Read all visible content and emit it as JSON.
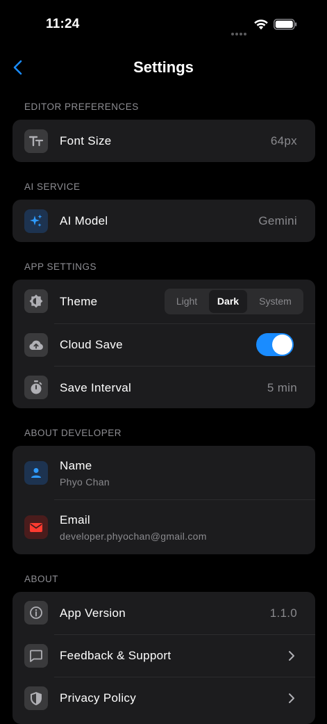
{
  "status": {
    "time": "11:24"
  },
  "nav": {
    "title": "Settings"
  },
  "editor": {
    "header": "EDITOR PREFERENCES",
    "font_size": {
      "label": "Font Size",
      "value": "64px"
    }
  },
  "ai": {
    "header": "AI SERVICE",
    "model": {
      "label": "AI Model",
      "value": "Gemini"
    }
  },
  "app": {
    "header": "APP SETTINGS",
    "theme": {
      "label": "Theme",
      "options": [
        "Light",
        "Dark",
        "System"
      ],
      "selected": "Dark"
    },
    "cloud_save": {
      "label": "Cloud Save",
      "enabled": true
    },
    "save_interval": {
      "label": "Save Interval",
      "value": "5 min"
    }
  },
  "developer": {
    "header": "ABOUT DEVELOPER",
    "name": {
      "label": "Name",
      "value": "Phyo Chan"
    },
    "email": {
      "label": "Email",
      "value": "developer.phyochan@gmail.com"
    }
  },
  "about": {
    "header": "ABOUT",
    "version": {
      "label": "App Version",
      "value": "1.1.0"
    },
    "feedback": {
      "label": "Feedback & Support"
    },
    "privacy": {
      "label": "Privacy Policy"
    }
  },
  "colors": {
    "accent": "#1a8cff",
    "email_icon": "#ff3b30",
    "group_bg": "#1c1c1e"
  },
  "icons": {
    "font_size": "text-size-icon",
    "ai_model": "sparkles-icon",
    "theme": "brightness-icon",
    "cloud_save": "cloud-upload-icon",
    "save_interval": "stopwatch-icon",
    "name": "person-icon",
    "email": "mail-icon",
    "version": "info-icon",
    "feedback": "chat-bubble-icon",
    "privacy": "shield-icon"
  }
}
